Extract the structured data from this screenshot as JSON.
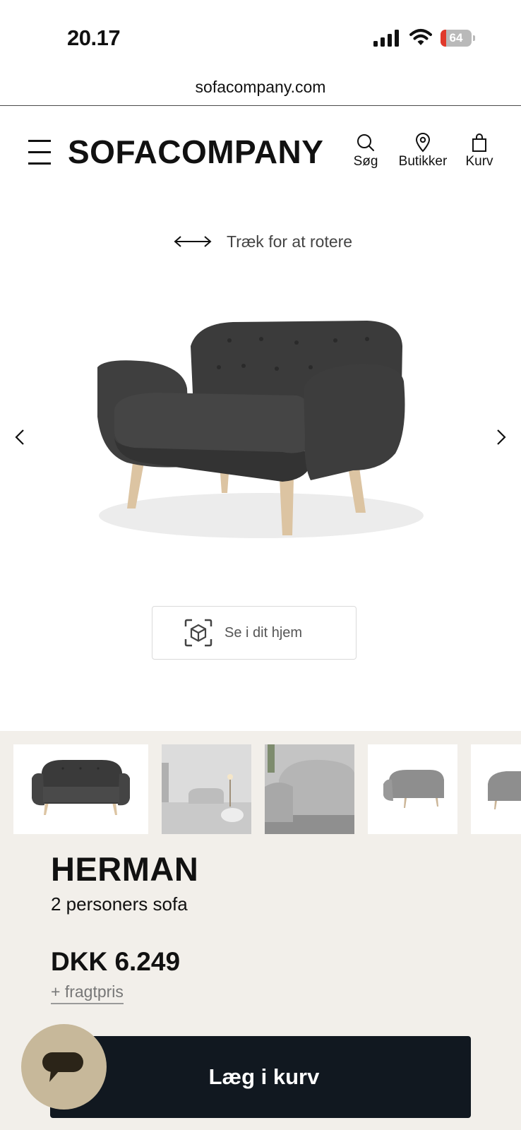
{
  "status_bar": {
    "time": "20.17",
    "battery_text": "64",
    "battery_level": 0.18,
    "icons": [
      "signal-icon",
      "wifi-icon",
      "battery-icon"
    ]
  },
  "browser": {
    "url": "sofacompany.com"
  },
  "header": {
    "logo": "SOFACOMPANY",
    "nav": [
      {
        "label": "Søg",
        "icon": "search-icon"
      },
      {
        "label": "Butikker",
        "icon": "location-pin-icon"
      },
      {
        "label": "Kurv",
        "icon": "shopping-bag-icon"
      }
    ]
  },
  "viewer": {
    "rotate_hint": "Træk for at rotere",
    "ar_button_label": "Se i dit hjem"
  },
  "product": {
    "name": "HERMAN",
    "subtitle": "2 personers sofa",
    "price": "DKK 6.249",
    "freight": "+ fragtpris",
    "add_to_cart_label": "Læg i kurv"
  },
  "colors": {
    "accent_dark": "#111820",
    "section_bg": "#f2efea",
    "chat_bubble": "#c7b89a",
    "sofa_fabric": "#3a3a3a",
    "sofa_legs": "#dcc4a2"
  }
}
